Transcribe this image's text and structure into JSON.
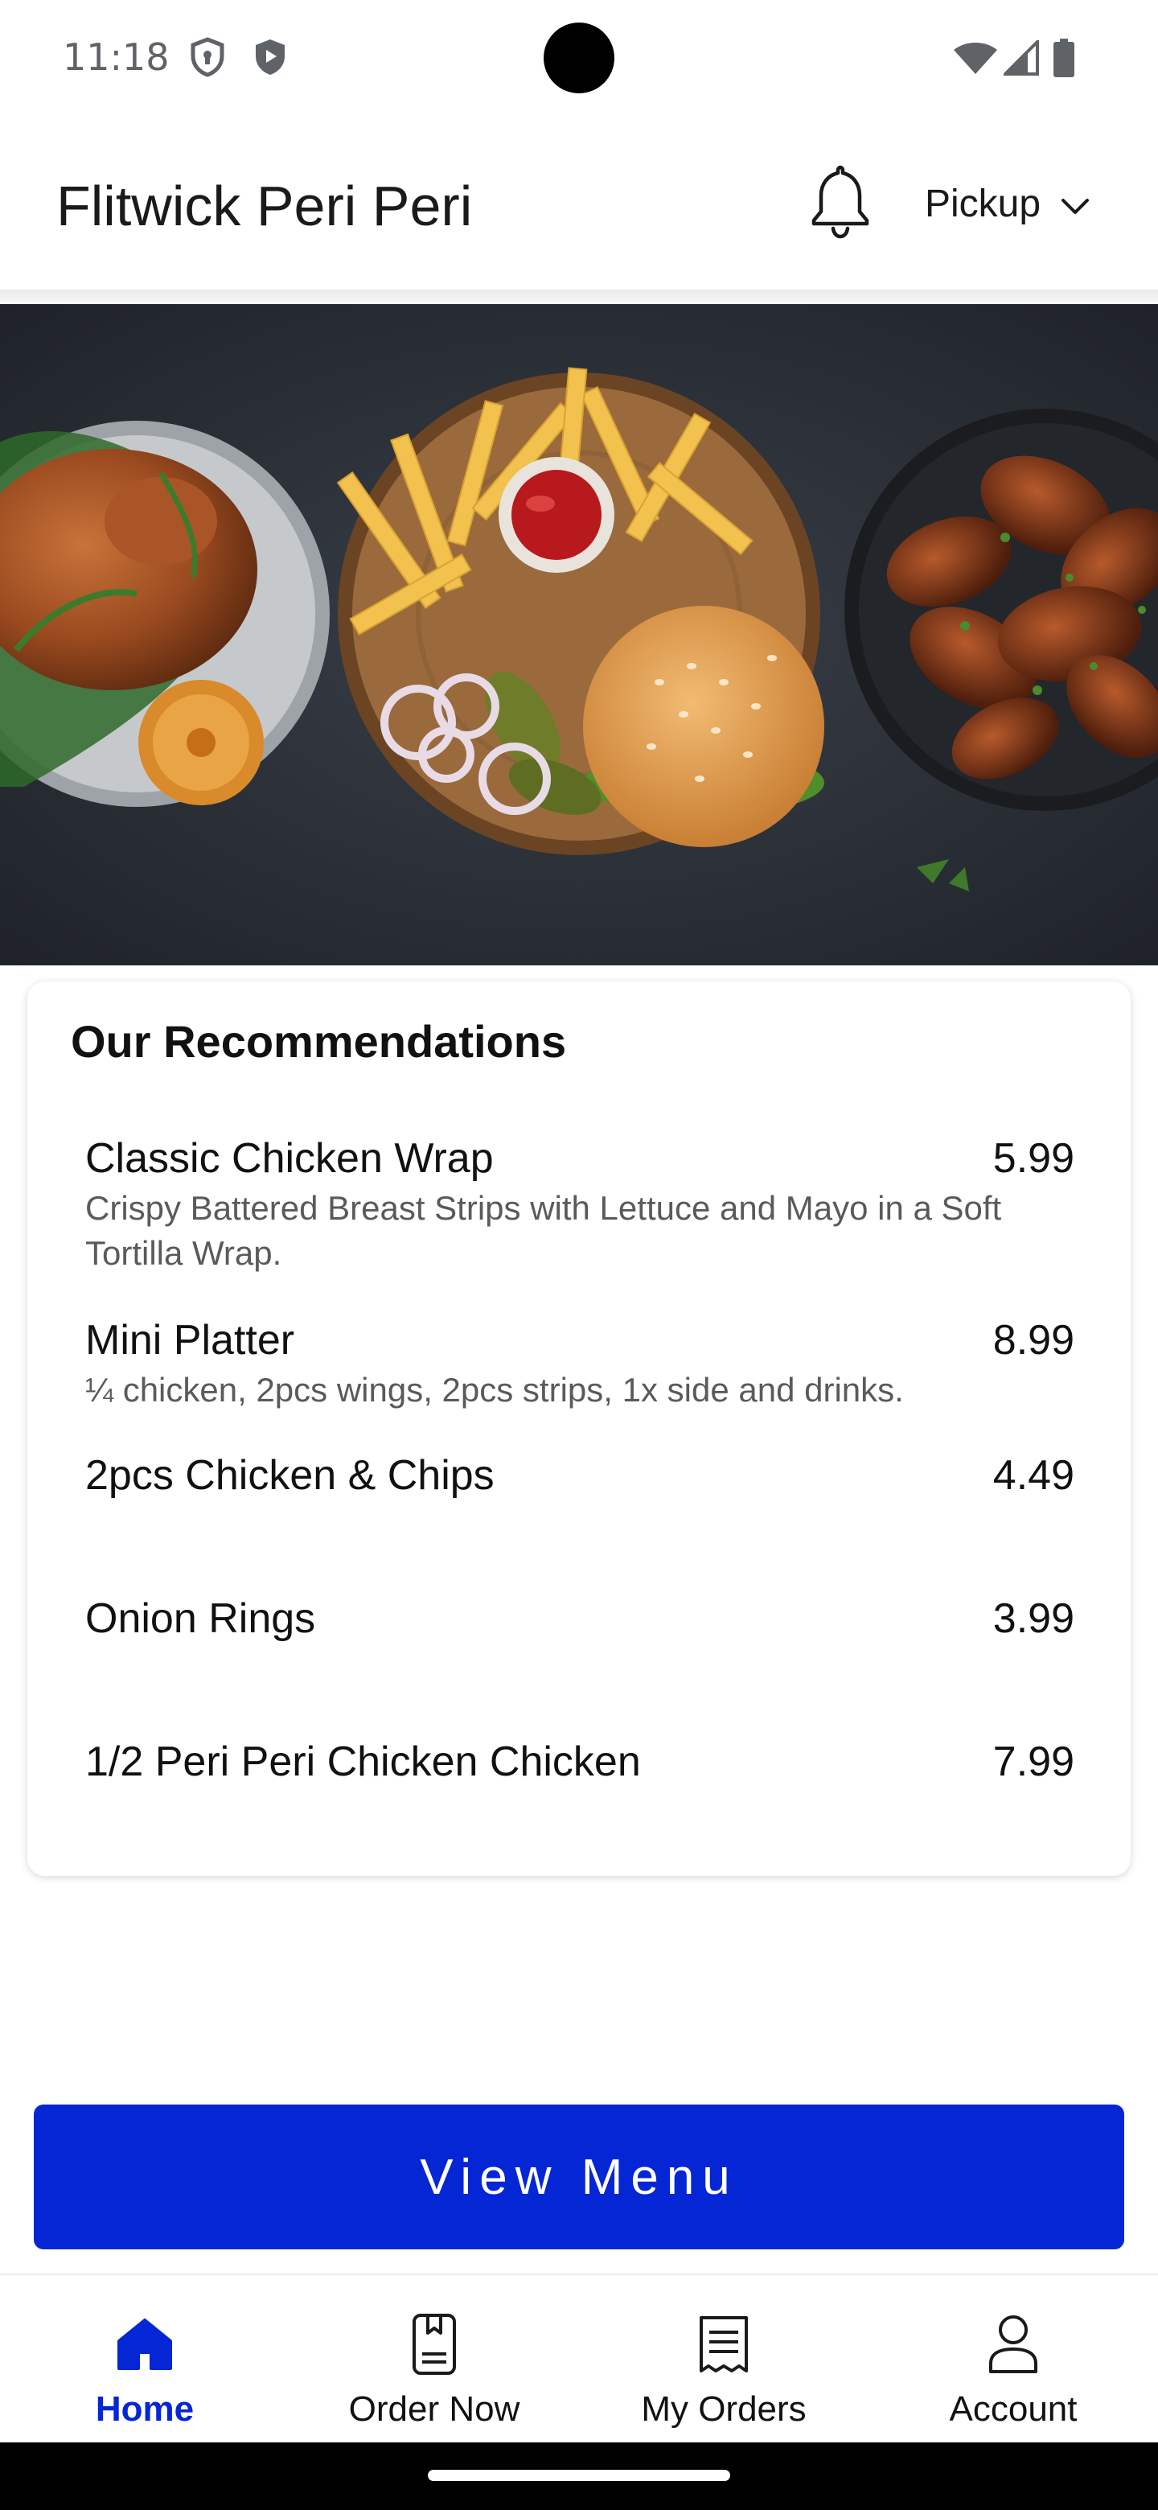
{
  "status_bar": {
    "time": "11:18"
  },
  "header": {
    "title": "Flitwick Peri Peri",
    "mode_selector": "Pickup"
  },
  "recommendations": {
    "title": "Our Recommendations",
    "items": [
      {
        "name": "Classic Chicken Wrap",
        "price": "5.99",
        "description": "Crispy Battered Breast Strips with Lettuce and Mayo in a Soft Tortilla Wrap."
      },
      {
        "name": "Mini Platter",
        "price": "8.99",
        "description": "¼ chicken, 2pcs wings, 2pcs strips, 1x side and drinks."
      },
      {
        "name": "2pcs Chicken & Chips",
        "price": "4.49",
        "description": ""
      },
      {
        "name": "Onion Rings",
        "price": "3.99",
        "description": ""
      },
      {
        "name": "1/2 Peri Peri Chicken Chicken",
        "price": "7.99",
        "description": ""
      }
    ]
  },
  "view_menu_label": "View Menu",
  "bottom_nav": {
    "items": [
      {
        "label": "Home",
        "icon": "home-icon",
        "active": true
      },
      {
        "label": "Order Now",
        "icon": "order-icon",
        "active": false
      },
      {
        "label": "My Orders",
        "icon": "receipt-icon",
        "active": false
      },
      {
        "label": "Account",
        "icon": "user-icon",
        "active": false
      }
    ]
  },
  "colors": {
    "accent": "#0526d4",
    "text": "#111111",
    "muted_text": "#5a5a5a"
  }
}
